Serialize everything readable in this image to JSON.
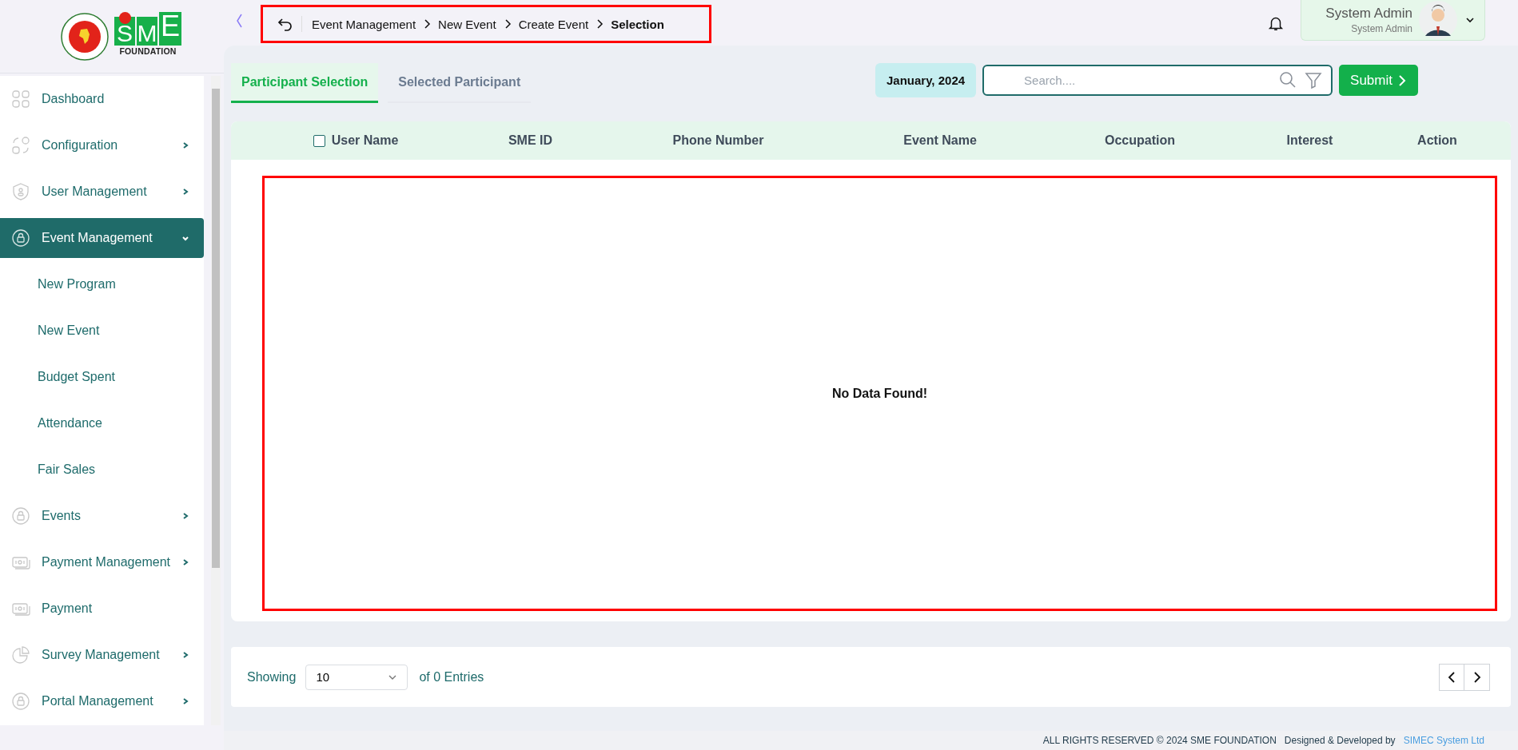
{
  "logo": {
    "letters": [
      "S",
      "M",
      "E"
    ],
    "subtitle": "FOUNDATION"
  },
  "sidebar": {
    "items": [
      {
        "label": "Dashboard",
        "kind": "link",
        "selected": false
      },
      {
        "label": "Configuration",
        "kind": "group",
        "selected": false,
        "expanded": false
      },
      {
        "label": "User Management",
        "kind": "group",
        "selected": false,
        "expanded": false
      },
      {
        "label": "Event Management",
        "kind": "group",
        "selected": true,
        "expanded": true,
        "children": [
          {
            "label": "New Program"
          },
          {
            "label": "New Event"
          },
          {
            "label": "Budget Spent"
          },
          {
            "label": "Attendance"
          },
          {
            "label": "Fair Sales"
          }
        ]
      },
      {
        "label": "Events",
        "kind": "group",
        "selected": false,
        "expanded": false
      },
      {
        "label": "Payment Management",
        "kind": "group",
        "selected": false,
        "expanded": false
      },
      {
        "label": "Payment",
        "kind": "link",
        "selected": false
      },
      {
        "label": "Survey Management",
        "kind": "group",
        "selected": false,
        "expanded": false
      },
      {
        "label": "Portal Management",
        "kind": "group",
        "selected": false,
        "expanded": false
      }
    ]
  },
  "header": {
    "breadcrumbs": [
      "Event Management",
      "New Event",
      "Create Event",
      "Selection"
    ],
    "user": {
      "name": "System Admin",
      "role": "System Admin"
    }
  },
  "tabs": [
    {
      "label": "Participant Selection",
      "selected": true
    },
    {
      "label": "Selected Participant",
      "selected": false
    }
  ],
  "toolbar": {
    "period": "January, 2024",
    "search": {
      "placeholder": "Search...."
    },
    "submit": "Submit"
  },
  "table": {
    "select_all_checked": false,
    "columns": [
      "User Name",
      "SME ID",
      "Phone Number",
      "Event Name",
      "Occupation",
      "Interest",
      "Action"
    ],
    "empty_message": "No Data Found!"
  },
  "pagination": {
    "prefix": "Showing",
    "page_size": "10",
    "suffix": "of 0 Entries"
  },
  "footer": {
    "copyright": "ALL RIGHTS RESERVED © 2024 SME FOUNDATION",
    "credit": "Designed & Developed by",
    "developer": "SIMEC System Ltd"
  }
}
